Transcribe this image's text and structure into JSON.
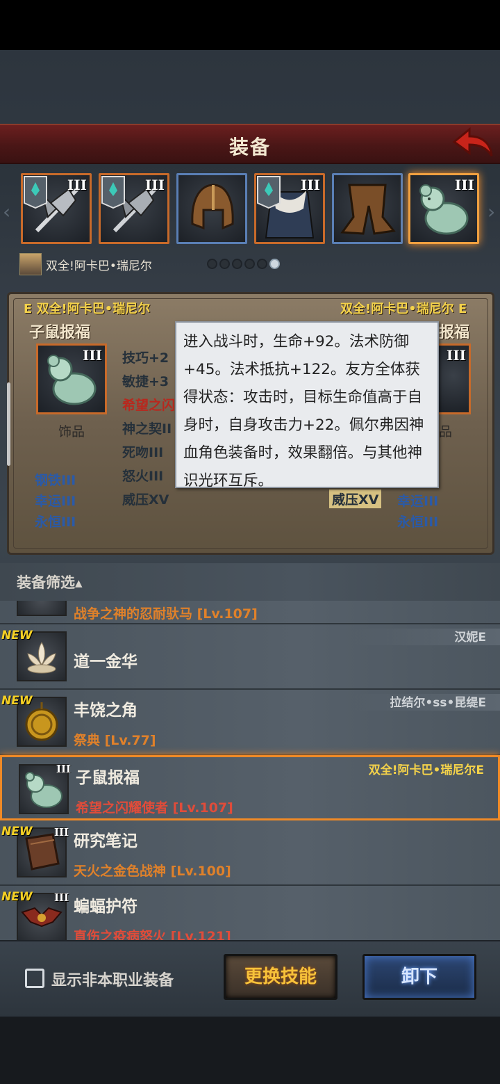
{
  "header": {
    "title": "装备"
  },
  "slots": [
    {
      "icon": "halberd-icon",
      "tier": "III",
      "badged": true
    },
    {
      "icon": "halberd-icon",
      "tier": "III",
      "badged": true
    },
    {
      "icon": "helmet-icon",
      "tier": "",
      "badged": false
    },
    {
      "icon": "fur-robe-icon",
      "tier": "III",
      "badged": true
    },
    {
      "icon": "leather-pants-icon",
      "tier": "",
      "badged": false
    },
    {
      "icon": "jade-rat-icon",
      "tier": "III",
      "badged": false
    }
  ],
  "character": {
    "name": "双全!阿卡巴•瑞尼尔"
  },
  "pager": {
    "count": 6,
    "active": 5
  },
  "compare": {
    "left_owner": "E 双全!阿卡巴•瑞尼尔",
    "right_owner": "双全!阿卡巴•瑞尼尔 E",
    "left_item": "子鼠报福",
    "right_item_partial": "报福",
    "tier": "III",
    "type": "饰品",
    "type_right": "品",
    "stats_mid": [
      "技巧+2",
      "敏捷+3",
      "希望之闪",
      "神之契II",
      "死吻III",
      "怒火III",
      "威压XV"
    ],
    "stats_left": [
      "钢铁III",
      "幸运III",
      "永恒III"
    ],
    "stats_right": [
      "幸运III",
      "永恒III"
    ],
    "right_highlight": "威压XV"
  },
  "tooltip": {
    "text": "进入战斗时，生命+92。法术防御+45。法术抵抗+122。友方全体获得状态：攻击时，目标生命值高于自身时，自身攻击力+22。佩尔弗因神血角色装备时，效果翻倍。与其他神识光环互斥。"
  },
  "filter": {
    "label": "装备筛选▴"
  },
  "list": [
    {
      "new": "",
      "name": "",
      "sub": "战争之神的忍耐驮马 [Lv.107]",
      "owner": "",
      "tier": ""
    },
    {
      "new": "NEW",
      "name": "道一金华",
      "sub": "",
      "owner": "汉妮E",
      "tier": ""
    },
    {
      "new": "NEW",
      "name": "丰饶之角",
      "sub": "祭典 [Lv.77]",
      "owner": "拉结尔•ss•昆缇E",
      "tier": ""
    },
    {
      "new": "",
      "name": "子鼠报福",
      "sub": "希望之闪耀使者 [Lv.107]",
      "owner": "双全!阿卡巴•瑞尼尔E",
      "tier": "III"
    },
    {
      "new": "NEW",
      "name": "研究笔记",
      "sub": "天火之金色战神 [Lv.100]",
      "owner": "",
      "tier": "III"
    },
    {
      "new": "NEW",
      "name": "蝙蝠护符",
      "sub": "直伤之疫病怒火 [Lv.121]",
      "owner": "",
      "tier": "III"
    }
  ],
  "footer": {
    "checkbox_label": "显示非本职业装备",
    "skill_button": "更换技能",
    "unequip_button": "卸下"
  }
}
